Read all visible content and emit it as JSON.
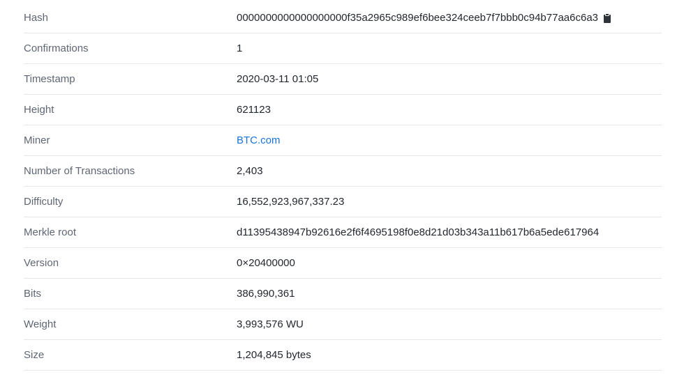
{
  "block_details": {
    "rows": [
      {
        "label": "Hash",
        "value": "0000000000000000000f35a2965c989ef6bee324ceeb7f7bbb0c94b77aa6c6a3",
        "icon": "clipboard-icon"
      },
      {
        "label": "Confirmations",
        "value": "1"
      },
      {
        "label": "Timestamp",
        "value": "2020-03-11 01:05"
      },
      {
        "label": "Height",
        "value": "621123"
      },
      {
        "label": "Miner",
        "value": "BTC.com",
        "link_color": "#1a73d9"
      },
      {
        "label": "Number of Transactions",
        "value": "2,403"
      },
      {
        "label": "Difficulty",
        "value": "16,552,923,967,337.23"
      },
      {
        "label": "Merkle root",
        "value": "d11395438947b92616e2f6f4695198f0e8d21d03b343a11b617b6a5ede617964"
      },
      {
        "label": "Version",
        "value": "0×20400000"
      },
      {
        "label": "Bits",
        "value": "386,990,361"
      },
      {
        "label": "Weight",
        "value": "3,993,576 WU"
      },
      {
        "label": "Size",
        "value": "1,204,845 bytes"
      }
    ]
  }
}
